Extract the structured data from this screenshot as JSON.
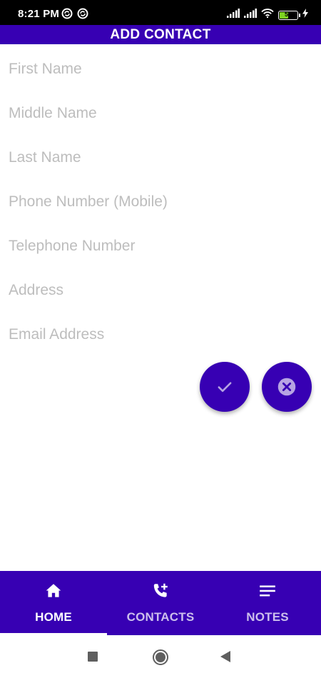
{
  "status_bar": {
    "time": "8:21 PM",
    "battery_level": "51",
    "battery_percent": 51,
    "icons": [
      "sync-badge-icon",
      "sync-badge-icon",
      "signal-icon",
      "signal-icon",
      "wifi-icon",
      "battery-icon",
      "charging-bolt-icon"
    ]
  },
  "app_bar": {
    "title": "ADD CONTACT"
  },
  "form": {
    "fields": [
      {
        "placeholder": "First Name",
        "value": ""
      },
      {
        "placeholder": "Middle Name",
        "value": ""
      },
      {
        "placeholder": "Last Name",
        "value": ""
      },
      {
        "placeholder": "Phone Number (Mobile)",
        "value": ""
      },
      {
        "placeholder": "Telephone Number",
        "value": ""
      },
      {
        "placeholder": "Address",
        "value": ""
      },
      {
        "placeholder": "Email Address",
        "value": ""
      }
    ]
  },
  "actions": {
    "save_icon": "check-icon",
    "cancel_icon": "cancel-circle-icon"
  },
  "bottom_nav": {
    "items": [
      {
        "label": "HOME",
        "icon": "home-icon",
        "active": true
      },
      {
        "label": "CONTACTS",
        "icon": "add-call-icon",
        "active": false
      },
      {
        "label": "NOTES",
        "icon": "notes-icon",
        "active": false
      }
    ]
  },
  "system_nav": {
    "buttons": [
      "recents-button",
      "home-button",
      "back-button"
    ]
  },
  "colors": {
    "primary": "#3700b3",
    "status_bar": "#000000",
    "placeholder": "#bdbdbd",
    "battery": "#7ed321"
  }
}
